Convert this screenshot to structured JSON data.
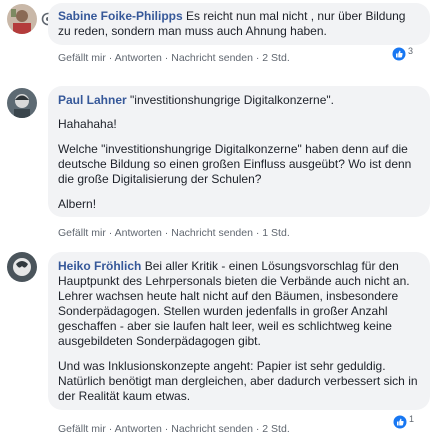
{
  "comments": [
    {
      "author": "Sabine Foike-Philipps",
      "paragraphs": [
        "Es reicht nun mal nicht , nur über Bildung zu reden, sondern man muss auch Ahnung haben."
      ],
      "actions": {
        "like": "Gefällt mir",
        "reply": "Antworten",
        "message": "Nachricht senden",
        "time": "2 Std."
      },
      "reaction_count": "3"
    },
    {
      "author": "Paul Lahner",
      "paragraphs": [
        "\"investitionshungrige Digitalkonzerne\".",
        "Hahahaha!",
        "Welche \"investitionshungrige Digitalkonzerne\" haben denn auf die deutsche Bildung so einen großen Einfluss ausgeübt? Wo ist denn die große Digitalisierung der Schulen?",
        "Albern!"
      ],
      "actions": {
        "like": "Gefällt mir",
        "reply": "Antworten",
        "message": "Nachricht senden",
        "time": "1 Std."
      }
    },
    {
      "author": "Heiko Fröhlich",
      "paragraphs": [
        "Bei aller Kritik - einen Lösungsvorschlag für den Hauptpunkt des Lehrpersonals bieten die Verbände auch nicht an. Lehrer wachsen heute halt nicht auf den Bäumen, insbesondere Sonderpädagogen. Stellen wurden jedenfalls in großer Anzahl geschaffen - aber sie laufen halt leer, weil es schlichtweg keine ausgebildeten Sonderpädagogen gibt.",
        "Und was Inklusionskonzepte angeht: Papier ist sehr geduldig. Natürlich benötigt man dergleichen, aber dadurch verbessert sich in der Realität kaum etwas."
      ],
      "actions": {
        "like": "Gefällt mir",
        "reply": "Antworten",
        "message": "Nachricht senden",
        "time": "2 Std."
      },
      "reaction_count": "1"
    }
  ],
  "separator": " · ",
  "colors": {
    "link": "#365899",
    "bubble": "#f2f3f5",
    "meta": "#606770",
    "like_blue": "#1877f2"
  },
  "icons": [
    "user-avatar-icon",
    "more-options-icon",
    "like-reaction-icon"
  ]
}
